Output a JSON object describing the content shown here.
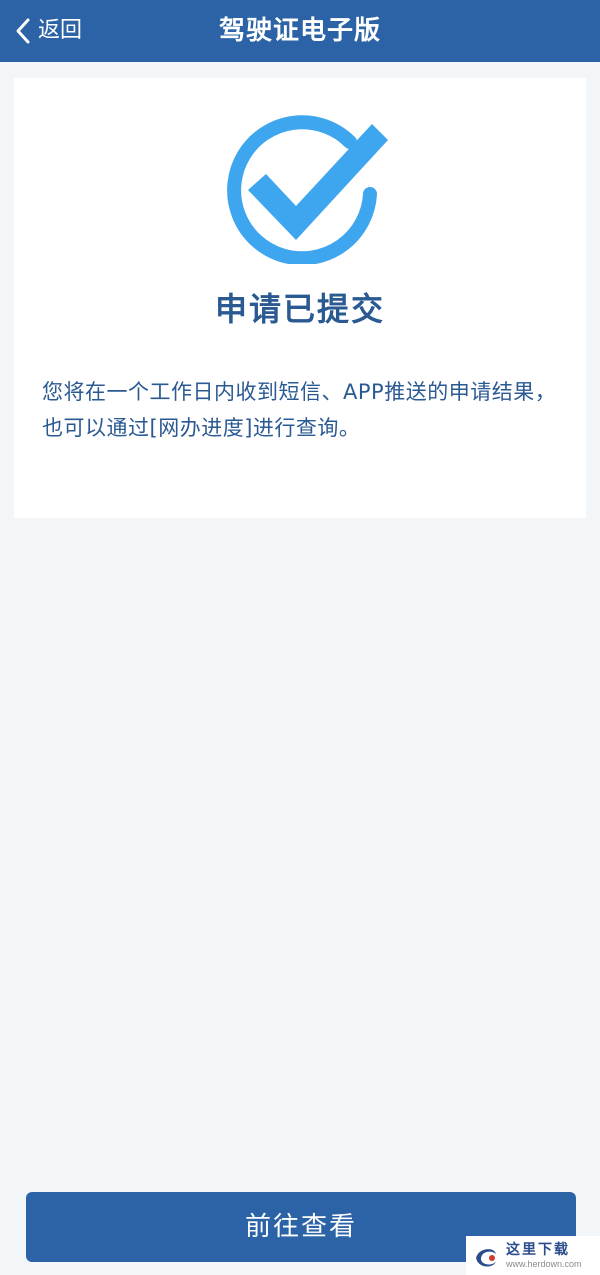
{
  "navbar": {
    "back_label": "返回",
    "title": "驾驶证电子版"
  },
  "card": {
    "status_icon": "check-circle-icon",
    "status_title": "申请已提交",
    "description": "您将在一个工作日内收到短信、APP推送的申请结果，也可以通过[网办进度]进行查询。"
  },
  "primary_button": {
    "label": "前往查看"
  },
  "watermark": {
    "cn": "这里下载",
    "url": "www.herdown.com"
  },
  "colors": {
    "brand": "#2b63a6",
    "title_text": "#2b5a93",
    "check_blue": "#3ea5ef",
    "page_bg": "#f2f6f8"
  }
}
